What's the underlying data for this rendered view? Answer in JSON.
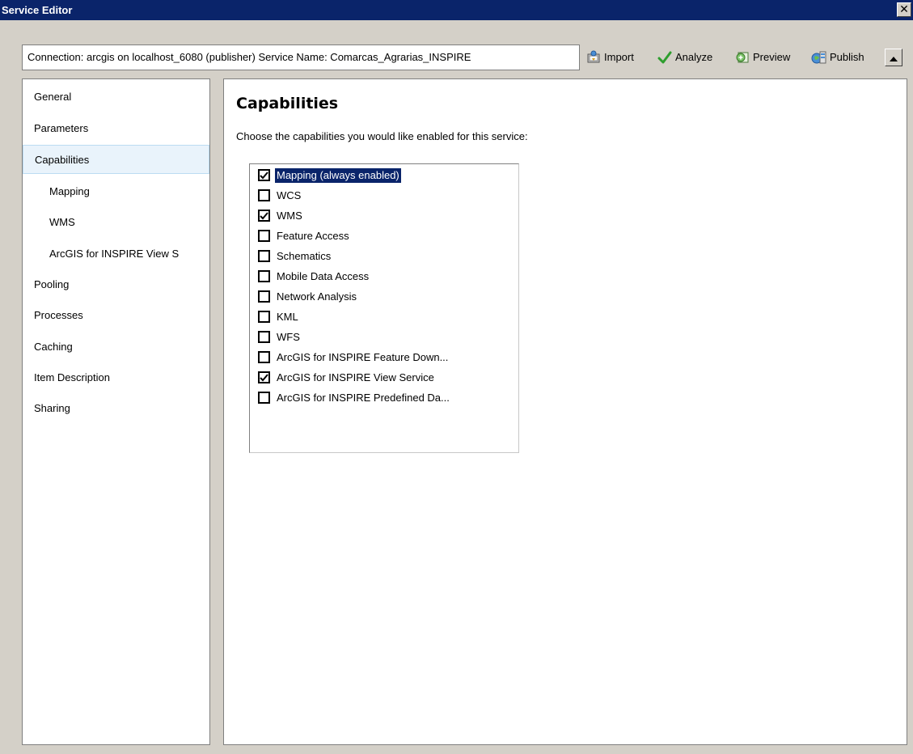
{
  "window": {
    "title": "Service Editor",
    "close_glyph": "✕"
  },
  "toolbar": {
    "connection_text": "Connection: arcgis on localhost_6080 (publisher)   Service Name: Comarcas_Agrarias_INSPIRE",
    "import_label": "Import",
    "analyze_label": "Analyze",
    "preview_label": "Preview",
    "publish_label": "Publish",
    "icons": [
      "import-icon",
      "analyze-check-icon",
      "preview-icon",
      "publish-icon",
      "collapse-arrow-up-icon"
    ]
  },
  "sidebar": {
    "items": [
      {
        "label": "General",
        "sub": false,
        "selected": false
      },
      {
        "label": "Parameters",
        "sub": false,
        "selected": false
      },
      {
        "label": "Capabilities",
        "sub": false,
        "selected": true
      },
      {
        "label": "Mapping",
        "sub": true,
        "selected": false
      },
      {
        "label": "WMS",
        "sub": true,
        "selected": false
      },
      {
        "label": "ArcGIS for INSPIRE View S",
        "sub": true,
        "selected": false
      },
      {
        "label": "Pooling",
        "sub": false,
        "selected": false
      },
      {
        "label": "Processes",
        "sub": false,
        "selected": false
      },
      {
        "label": "Caching",
        "sub": false,
        "selected": false
      },
      {
        "label": "Item Description",
        "sub": false,
        "selected": false
      },
      {
        "label": "Sharing",
        "sub": false,
        "selected": false
      }
    ]
  },
  "main": {
    "heading": "Capabilities",
    "description": "Choose the capabilities you would like enabled for this service:",
    "capabilities": [
      {
        "label": "Mapping (always enabled)",
        "checked": true,
        "selected": true
      },
      {
        "label": "WCS",
        "checked": false,
        "selected": false
      },
      {
        "label": "WMS",
        "checked": true,
        "selected": false
      },
      {
        "label": "Feature Access",
        "checked": false,
        "selected": false
      },
      {
        "label": "Schematics",
        "checked": false,
        "selected": false
      },
      {
        "label": "Mobile Data Access",
        "checked": false,
        "selected": false
      },
      {
        "label": "Network Analysis",
        "checked": false,
        "selected": false
      },
      {
        "label": "KML",
        "checked": false,
        "selected": false
      },
      {
        "label": "WFS",
        "checked": false,
        "selected": false
      },
      {
        "label": "ArcGIS for INSPIRE Feature Down...",
        "checked": false,
        "selected": false
      },
      {
        "label": "ArcGIS for INSPIRE View Service",
        "checked": true,
        "selected": false
      },
      {
        "label": "ArcGIS for INSPIRE Predefined Da...",
        "checked": false,
        "selected": false
      }
    ]
  },
  "colors": {
    "titlebar": "#0a246a",
    "selection": "#0a246a",
    "nav_selected_bg": "#e9f3fb",
    "analyze_check": "#2e9e2e"
  }
}
